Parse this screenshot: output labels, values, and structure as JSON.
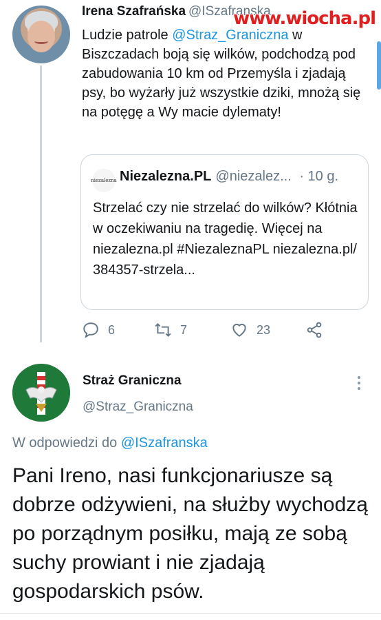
{
  "tweet1": {
    "author_name": "Irena Szafrańska",
    "author_handle": "@ISzafranska",
    "text_before": "Ludzie patrole ",
    "mention": "@Straz_Graniczna",
    "text_after": " w Biszczadach boją się wilków, podchodzą pod zabudowania 10 km od Przemyśla i zjadają psy, bo wyżarły już wszystkie dziki, mnożą się na potęgę a Wy macie dylematy!",
    "quote": {
      "logo_text": "niezalezna",
      "author_name": "Niezalezna.PL",
      "author_handle": "@niezalez...",
      "time": "· 10 g.",
      "text": "Strzelać czy nie strzelać do wilków? Kłótnia w oczekiwaniu na tragedię. Więcej na niezalezna.pl #NiezaleznaPL niezalezna.pl/ 384357-strzela..."
    },
    "actions": {
      "reply_count": "6",
      "retweet_count": "7",
      "like_count": "23"
    }
  },
  "watermark": "www.wiocha.pl",
  "tweet2": {
    "author_name": "Straż Graniczna",
    "author_handle": "@Straz_Graniczna",
    "reply_prefix": "W odpowiedzi do ",
    "reply_mention": "@ISzafranska",
    "text": "Pani Ireno, nasi funkcjonariusze są dobrze odżywieni, na służby wychodzą po porządnym posiłku, mają ze sobą suchy prowiant i nie zjadają gospodarskich psów."
  },
  "colors": {
    "link": "#1b95e0",
    "secondary_text": "#657786",
    "border": "#ccd6dd",
    "watermark": "#e02020",
    "avatar2_bg": "#1f7a3a"
  }
}
